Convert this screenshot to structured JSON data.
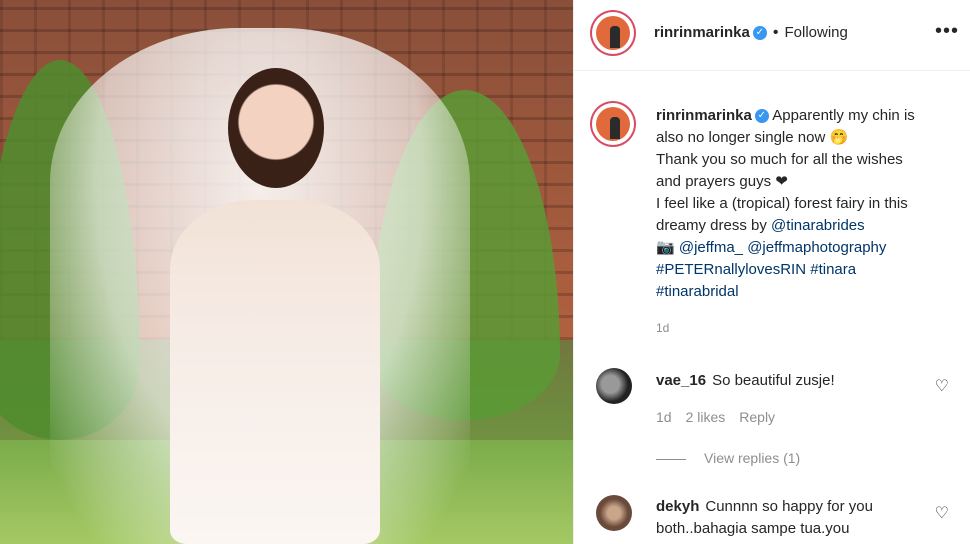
{
  "header": {
    "username": "rinrinmarinka",
    "verified_icon": "verified-badge-icon",
    "separator": "•",
    "follow_status": "Following",
    "more_icon": "•••"
  },
  "caption": {
    "username": "rinrinmarinka",
    "lines": [
      "Apparently my chin is",
      "also no longer single now 🤭",
      "Thank you so much for all the wishes",
      "and prayers guys ❤",
      "I feel like a (tropical) forest fairy in this",
      "dreamy dress by"
    ],
    "mention_brides": "@tinarabrides",
    "camera": "📷",
    "mention_jeffma": "@jeffma_",
    "mention_jeffma_photo": "@jeffmaphotography",
    "hashtag1": "#PETERnallylovesRIN",
    "hashtag2": "#tinara",
    "hashtag3": "#tinarabridal",
    "time": "1d"
  },
  "comments": [
    {
      "username": "vae_16",
      "text": "So beautiful zusje!",
      "time": "1d",
      "likes": "2 likes",
      "reply": "Reply"
    },
    {
      "username": "dekyh",
      "text": "Cunnnn so happy for you both..bahagia sampe tua.you"
    }
  ],
  "view_replies": "View replies (1)",
  "icons": {
    "heart": "♡"
  },
  "colors": {
    "link": "#003569",
    "verified": "#3897f0",
    "story_ring": "#d94a64"
  }
}
